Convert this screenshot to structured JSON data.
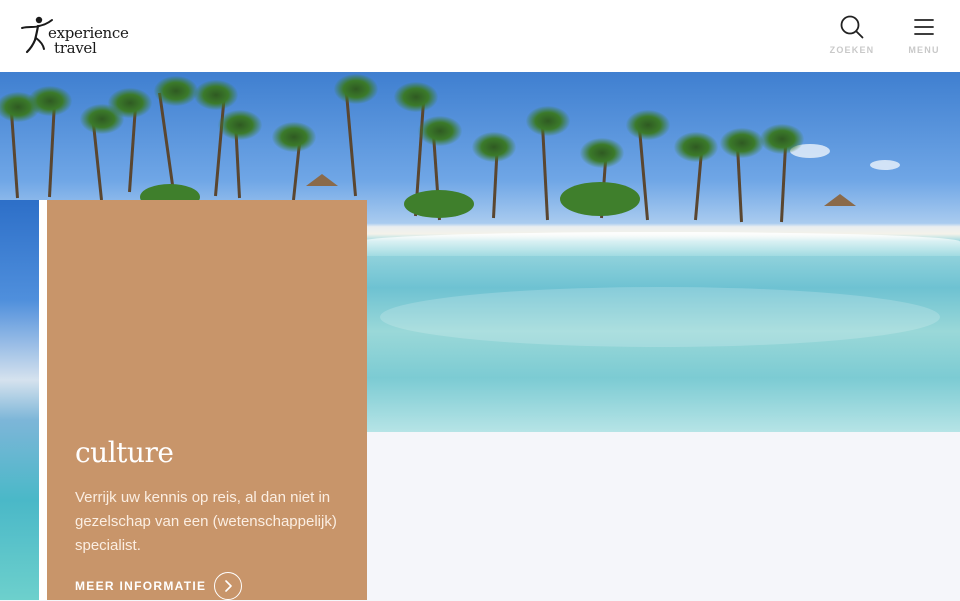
{
  "brand": {
    "line1": "experience",
    "line2": "travel"
  },
  "header": {
    "search": {
      "label": "ZOEKEN",
      "icon": "search-icon"
    },
    "menu": {
      "label": "MENU",
      "icon": "hamburger-icon"
    }
  },
  "hero": {
    "image": "tropical-beach-palms-under-over-water-photo"
  },
  "card": {
    "title": "culture",
    "description": "Verrijk uw kennis op reis, al dan niet in gezelschap van een (wetenschappelijk) specialist.",
    "link_label": "MEER INFORMATIE",
    "link_icon": "chevron-right-icon",
    "color": "#c8956a"
  },
  "colors": {
    "accent_card": "#c8956a",
    "header_bg": "#ffffff",
    "muted_label": "#c9c9c9"
  }
}
